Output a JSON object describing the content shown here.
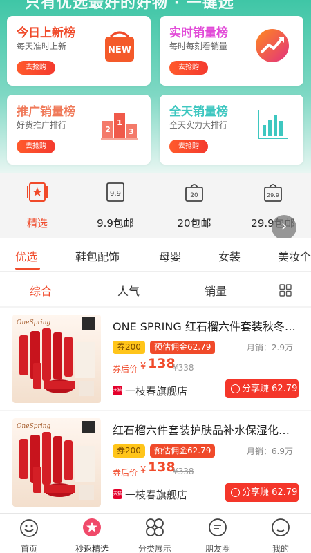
{
  "hero": {
    "title": "只有优选最好的好物 · 一键选"
  },
  "cards": [
    {
      "title": "今日上新榜",
      "subtitle": "每天准时上新",
      "button": "去抢购",
      "title_color": "#f04a2a",
      "icon": "new-bag-icon"
    },
    {
      "title": "实时销量榜",
      "subtitle": "每时每刻看销量",
      "button": "去抢购",
      "title_color": "#e24bd8",
      "icon": "trend-up-icon"
    },
    {
      "title": "推广销量榜",
      "subtitle": "好货推广排行",
      "button": "去抢购",
      "title_color": "#f07a5a",
      "icon": "podium-icon"
    },
    {
      "title": "全天销量榜",
      "subtitle": "全天实力大排行",
      "button": "去抢购",
      "title_color": "#3ec7c0",
      "icon": "bar-chart-icon"
    }
  ],
  "quick_nav": [
    {
      "label": "精选",
      "icon": "featured-star-icon",
      "active": true
    },
    {
      "label": "9.9包邮",
      "icon": "price-tag-9-9-icon",
      "badge": "9.9"
    },
    {
      "label": "20包邮",
      "icon": "shopping-bag-20-icon",
      "badge": "20"
    },
    {
      "label": "29.9包邮",
      "icon": "shopping-bag-29-9-icon",
      "badge": "29.9"
    }
  ],
  "tabs": [
    "优选",
    "鞋包配饰",
    "母婴",
    "女装",
    "美妆个"
  ],
  "sort": [
    "综合",
    "人气",
    "销量"
  ],
  "products": [
    {
      "title": "ONE SPRING 红石榴六件套装秋冬补水保湿",
      "coupon": "券200",
      "commission": "预估佣金62.79",
      "sales": "月销：2.9万",
      "after_label": "券后价",
      "price_symbol": "¥",
      "price": "138",
      "original_price": "¥338",
      "shop": "一枝春旗舰店",
      "shop_badge": "天猫",
      "share": "分享赚 62.79",
      "brand": "OneSpring"
    },
    {
      "title": "红石榴六件套装护肤品补水保湿化妆品",
      "coupon": "券200",
      "commission": "预估佣金62.79",
      "sales": "月销：6.9万",
      "after_label": "券后价",
      "price_symbol": "¥",
      "price": "138",
      "original_price": "¥338",
      "shop": "一枝春旗舰店",
      "shop_badge": "天猫",
      "share": "分享赚 62.79",
      "brand": "OneSpring"
    }
  ],
  "bottom_nav": [
    {
      "label": "首页",
      "icon": "home-icon"
    },
    {
      "label": "秒返精选",
      "icon": "star-badge-icon",
      "active": true
    },
    {
      "label": "分类展示",
      "icon": "category-grid-icon"
    },
    {
      "label": "朋友圈",
      "icon": "chat-bubble-icon"
    },
    {
      "label": "我的",
      "icon": "profile-face-icon"
    }
  ],
  "colors": {
    "accent": "#f04a2a",
    "hero_teal": "#3fc6a6",
    "coupon_yellow": "#ffc51a"
  }
}
